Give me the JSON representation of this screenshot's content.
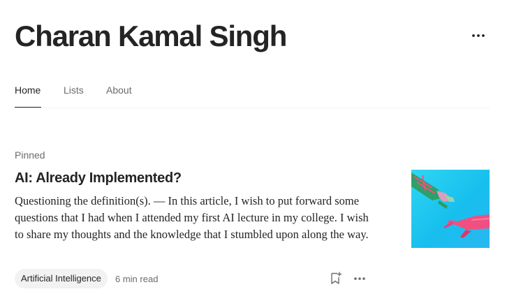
{
  "header": {
    "title": "Charan Kamal Singh",
    "more_icon": "more-horizontal-icon"
  },
  "tabs": [
    {
      "label": "Home",
      "active": true
    },
    {
      "label": "Lists",
      "active": false
    },
    {
      "label": "About",
      "active": false
    }
  ],
  "post": {
    "pinned_label": "Pinned",
    "title": "AI: Already Implemented?",
    "excerpt": "Questioning the definition(s). — In this article, I wish to put forward some questions that I had when I attended my first AI lecture in my college. I wish to share my thoughts and the knowledge that I stumbled upon along the way.",
    "tag": "Artificial Intelligence",
    "read_time": "6 min read",
    "save_icon": "bookmark-add-icon",
    "more_icon": "more-horizontal-icon",
    "thumbnail_icon": "robot-hand-reaching-human-hand-image"
  },
  "colors": {
    "text": "#242424",
    "muted": "#6b6b6b",
    "tag_bg": "#f2f2f2",
    "thumb_bg": "#1ec3ef",
    "hand_pink": "#f0507f",
    "circuit_green": "#2f9a5a"
  }
}
